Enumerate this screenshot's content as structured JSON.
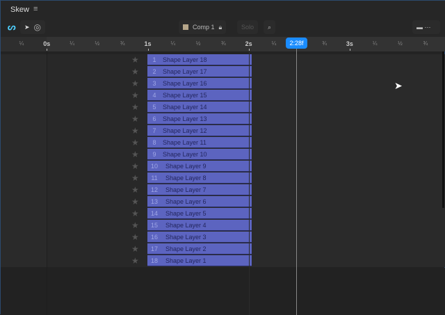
{
  "panel": {
    "title": "Skew",
    "menu_icon": "hamburger-icon"
  },
  "toolbar": {
    "comp_label": "Comp 1",
    "solo_label": "Solo"
  },
  "ruler": {
    "ticks": [
      "¼",
      "0s",
      "¼",
      "½",
      "¾",
      "1s",
      "¼",
      "½",
      "¾",
      "2s",
      "¼",
      "",
      "¾",
      "3s",
      "¼",
      "½",
      "¾"
    ],
    "playhead": "2:28f"
  },
  "layers": [
    {
      "num": "1",
      "name": "Shape Layer 18"
    },
    {
      "num": "2",
      "name": "Shape Layer 17"
    },
    {
      "num": "3",
      "name": "Shape Layer 16"
    },
    {
      "num": "4",
      "name": "Shape Layer 15"
    },
    {
      "num": "5",
      "name": "Shape Layer 14"
    },
    {
      "num": "6",
      "name": "Shape Layer 13"
    },
    {
      "num": "7",
      "name": "Shape Layer 12"
    },
    {
      "num": "8",
      "name": "Shape Layer 11"
    },
    {
      "num": "9",
      "name": "Shape Layer 10"
    },
    {
      "num": "10",
      "name": "Shape Layer 9"
    },
    {
      "num": "11",
      "name": "Shape Layer 8"
    },
    {
      "num": "12",
      "name": "Shape Layer 7"
    },
    {
      "num": "13",
      "name": "Shape Layer 6"
    },
    {
      "num": "14",
      "name": "Shape Layer 5"
    },
    {
      "num": "15",
      "name": "Shape Layer 4"
    },
    {
      "num": "16",
      "name": "Shape Layer 3"
    },
    {
      "num": "17",
      "name": "Shape Layer 2"
    },
    {
      "num": "18",
      "name": "Shape Layer 1"
    }
  ],
  "colors": {
    "bar": "#5c64c0",
    "playhead": "#1a8cff"
  }
}
